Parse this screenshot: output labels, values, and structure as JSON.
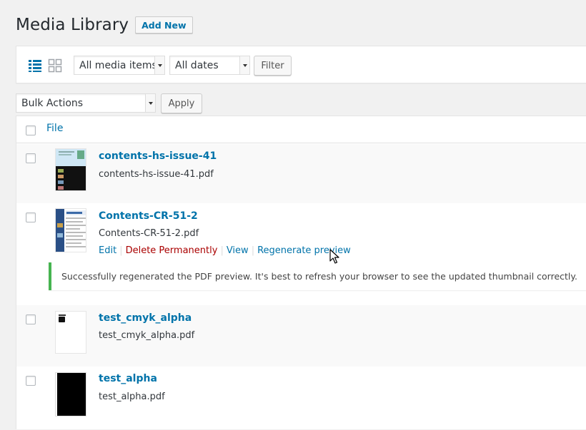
{
  "header": {
    "title": "Media Library",
    "add_new_label": "Add New"
  },
  "filters": {
    "view_list_icon": "list-view-icon",
    "view_grid_icon": "grid-view-icon",
    "media_type_selected": "All media items",
    "dates_selected": "All dates",
    "filter_button": "Filter"
  },
  "bulk": {
    "selected": "Bulk Actions",
    "apply_button": "Apply"
  },
  "table": {
    "column_file": "File",
    "rows": [
      {
        "title": "contents-hs-issue-41",
        "filename": "contents-hs-issue-41.pdf"
      },
      {
        "title": "Contents-CR-51-2",
        "filename": "Contents-CR-51-2.pdf",
        "actions": {
          "edit": "Edit",
          "delete": "Delete Permanently",
          "view": "View",
          "regenerate": "Regenerate preview"
        },
        "notice": "Successfully regenerated the PDF preview. It's best to refresh your browser to see the updated thumbnail correctly."
      },
      {
        "title": "test_cmyk_alpha",
        "filename": "test_cmyk_alpha.pdf"
      },
      {
        "title": "test_alpha",
        "filename": "test_alpha.pdf"
      }
    ]
  },
  "colors": {
    "link": "#0073aa",
    "delete": "#aa0000",
    "notice_success": "#46b450"
  }
}
